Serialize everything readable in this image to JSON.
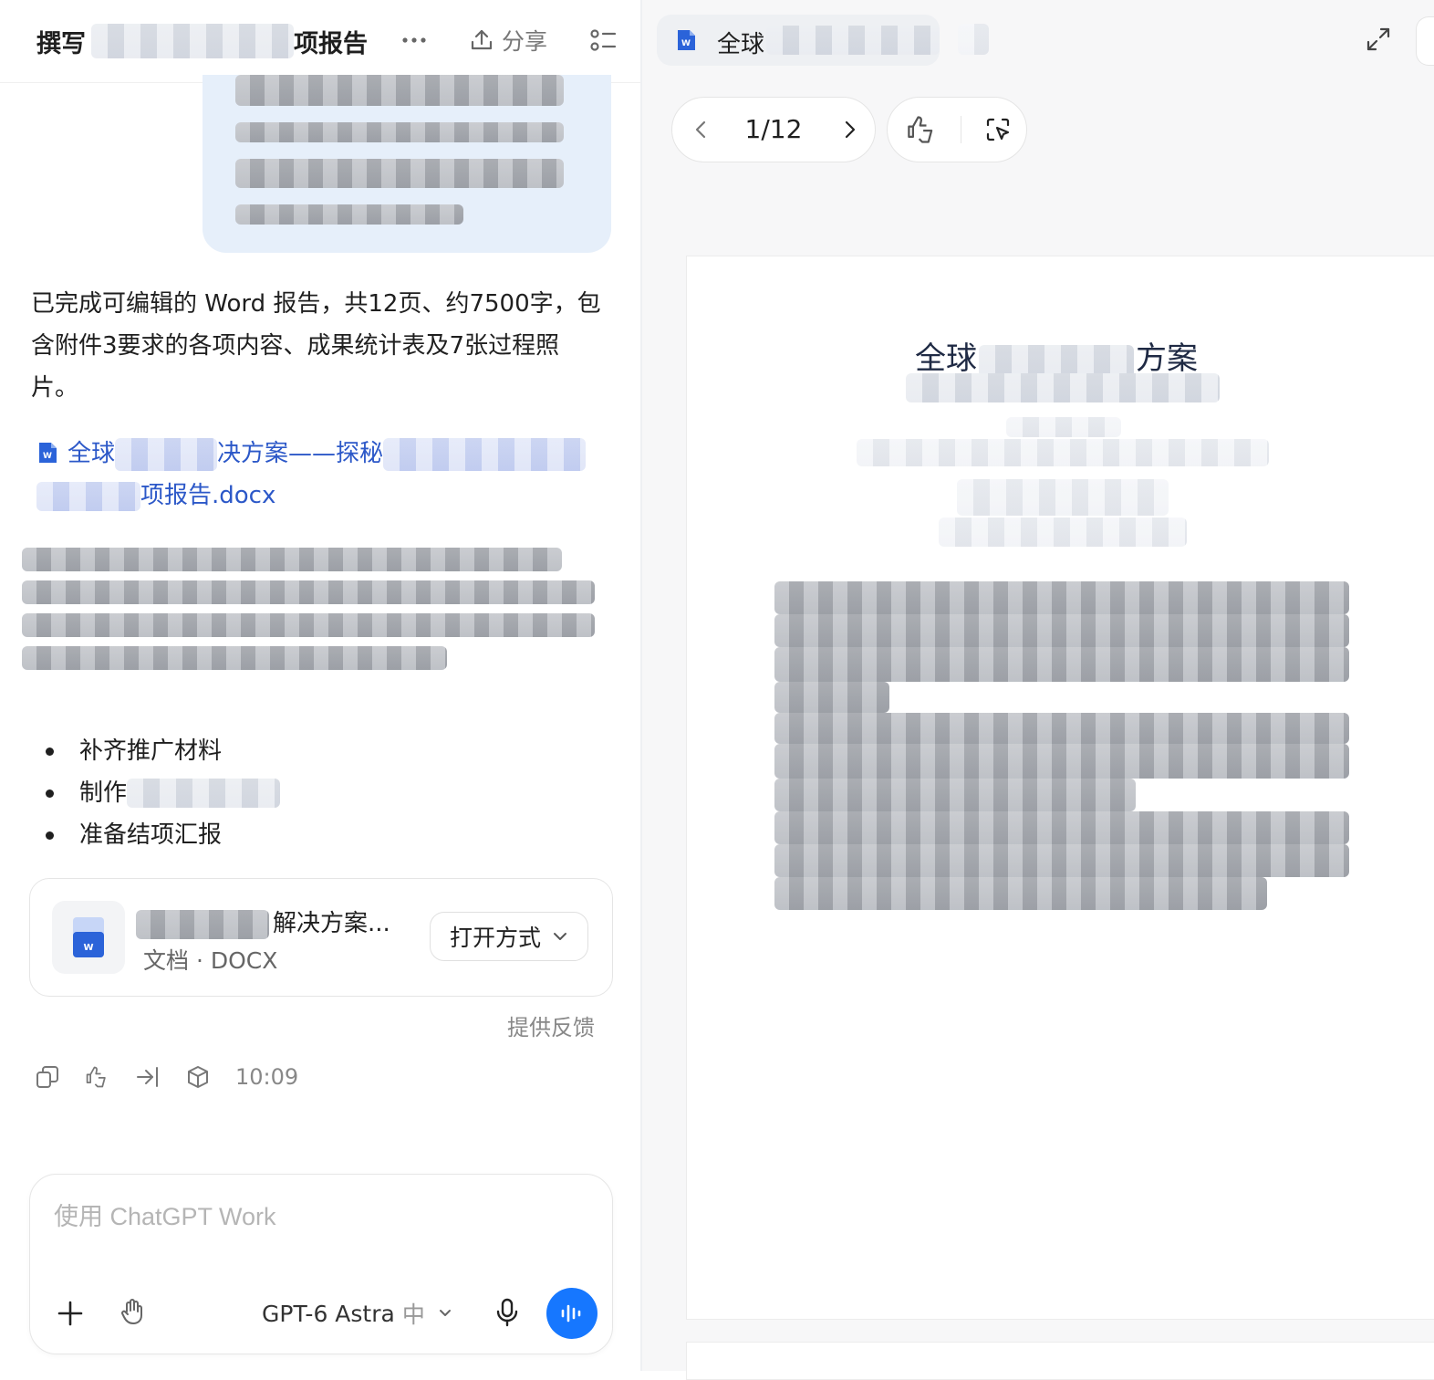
{
  "left_pane": {
    "title_prefix": "撰写",
    "title_suffix": "项报告",
    "share_label": "分享",
    "reply": {
      "text": "已完成可编辑的 Word 报告，共12页、约7500字，包含附件3要求的各项内容、成果统计表及7张过程照片。",
      "file_link_part1": "全球",
      "file_link_part2": "决方案——探秘",
      "file_link_part3": "项报告.docx"
    },
    "bullets": [
      "补齐推广材料",
      "制作",
      "准备结项汇报"
    ],
    "file_card": {
      "name_visible": "解决方案...",
      "subtitle": "文档 · DOCX",
      "open_with_label": "打开方式"
    },
    "feedback_label": "提供反馈",
    "timestamp": "10:09",
    "composer": {
      "placeholder": "使用 ChatGPT Work",
      "model_label": "GPT-6 Astra",
      "model_effort": "中"
    }
  },
  "right_pane": {
    "tab_title": "全球",
    "page_indicator": "1/12",
    "doc_heading_start": "全球",
    "doc_heading_end": "方案"
  },
  "colors": {
    "accent": "#1677ff",
    "link": "#2c58c8",
    "user_bubble": "#e6effa"
  },
  "icons": [
    "more-icon",
    "share-icon",
    "list-icon",
    "word-doc-icon",
    "copy-icon",
    "feedback-icon",
    "share-arrow-icon",
    "cube-icon",
    "plus-icon",
    "hand-icon",
    "chevron-down-icon",
    "mic-icon",
    "voice-icon",
    "expand-icon",
    "chevron-left-icon",
    "chevron-right-icon",
    "select-icon"
  ]
}
